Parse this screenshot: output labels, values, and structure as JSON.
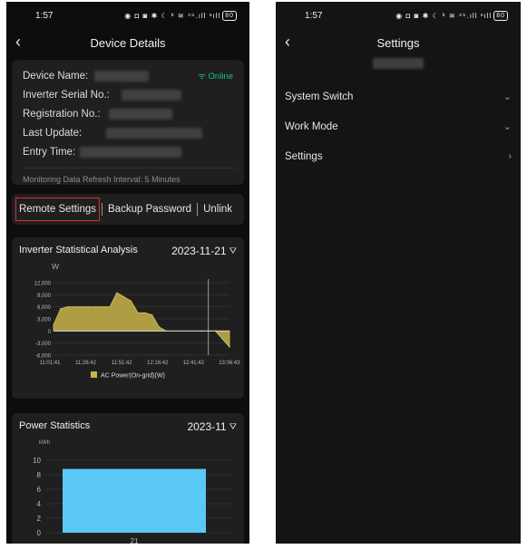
{
  "left": {
    "status": {
      "time": "1:57",
      "icons": "◉ ◘ ◙ ✱ ☾ ᵏ ≋ ⁴⁶.ıll ˢıll",
      "battery": "80"
    },
    "nav": {
      "back": "‹",
      "title": "Device Details"
    },
    "info": {
      "device_name_label": "Device Name:",
      "online": "Online",
      "serial_label": "Inverter Serial No.:",
      "registration_label": "Registration No.:",
      "last_update_label": "Last Update:",
      "entry_time_label": "Entry Time:",
      "refresh_interval": "Monitoring Data Refresh Interval: 5 Minutes"
    },
    "actions": {
      "remote_settings": "Remote Settings",
      "backup_password": "Backup Password",
      "unlink": "Unlink"
    },
    "analysis": {
      "title": "Inverter Statistical Analysis",
      "date": "2023-11-21"
    },
    "power": {
      "title": "Power Statistics",
      "date": "2023-11"
    }
  },
  "right": {
    "status": {
      "time": "1:57",
      "icons": "◉ ◘ ◙ ✱ ☾ ᵏ ≋ ⁴⁶.ıll ˢıll",
      "battery": "80"
    },
    "nav": {
      "back": "‹",
      "title": "Settings"
    },
    "menu": [
      {
        "label": "System Switch",
        "chevron": "⌄"
      },
      {
        "label": "Work Mode",
        "chevron": "⌄"
      },
      {
        "label": "Settings",
        "chevron": "›"
      }
    ]
  },
  "colors": {
    "bg": "#0d0d0d",
    "card": "#1f1f1f",
    "online": "#19c37d",
    "area": "#c8b44a",
    "bar": "#5ac8f5",
    "highlight": "#d93030"
  },
  "chart_data": [
    {
      "type": "area",
      "title": "",
      "ylabel": "W",
      "ylim": [
        -6000,
        12000
      ],
      "yticks": [
        "12,000",
        "9,000",
        "6,000",
        "3,000",
        "0",
        "-3,000",
        "-6,000"
      ],
      "xticks": [
        "11:01:41",
        "11:26:42",
        "11:51:42",
        "12:16:42",
        "12:41:42",
        "13:06:43"
      ],
      "series": [
        {
          "name": "AC Power(On-grid)(W)",
          "x": [
            "11:01:41",
            "11:06:41",
            "11:11:41",
            "11:16:41",
            "11:21:41",
            "11:26:42",
            "11:31:42",
            "11:36:42",
            "11:41:42",
            "11:46:42",
            "11:51:42",
            "11:56:42",
            "12:01:42",
            "12:06:42",
            "12:11:42",
            "12:16:42",
            "12:21:42",
            "12:26:42",
            "12:31:42",
            "12:36:42",
            "12:41:42",
            "12:46:42",
            "12:51:42",
            "12:56:42",
            "13:01:42",
            "13:06:43"
          ],
          "values": [
            1500,
            5500,
            6000,
            6000,
            6000,
            6000,
            6000,
            6000,
            6000,
            9500,
            8500,
            7500,
            4500,
            4500,
            4000,
            1000,
            0,
            0,
            0,
            0,
            0,
            0,
            0,
            0,
            -2000,
            -4000
          ]
        }
      ]
    },
    {
      "type": "bar",
      "title": "",
      "ylabel": "kWh",
      "ylim": [
        0,
        10
      ],
      "yticks": [
        "10",
        "8",
        "6",
        "4",
        "2",
        "0"
      ],
      "categories": [
        "21"
      ],
      "values": [
        8.8
      ]
    }
  ]
}
